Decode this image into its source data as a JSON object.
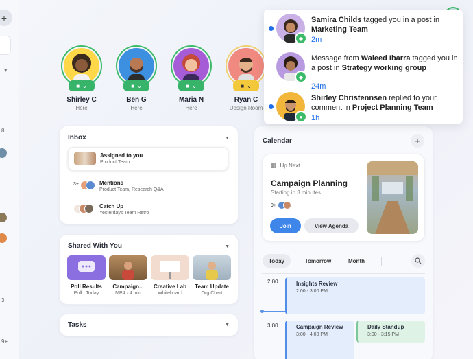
{
  "rail": {
    "plus_icon": "+",
    "chev_icon": "▾",
    "nums": [
      "8",
      "3",
      "9+"
    ]
  },
  "people": [
    {
      "name": "Shirley C",
      "status": "Here"
    },
    {
      "name": "Ben G",
      "status": "Here"
    },
    {
      "name": "Maria N",
      "status": "Here"
    },
    {
      "name": "Ryan C",
      "status": "Design Room"
    }
  ],
  "inbox": {
    "title": "Inbox",
    "items": [
      {
        "title": "Assigned to you",
        "subtitle": "Product Team"
      },
      {
        "title": "Mentions",
        "subtitle": "Product Team, Research Q&A",
        "count": "3+"
      },
      {
        "title": "Catch Up",
        "subtitle": "Yesterdays Team Retro"
      }
    ]
  },
  "shared": {
    "title": "Shared With You",
    "items": [
      {
        "title": "Poll Results",
        "subtitle": "Poll · Today"
      },
      {
        "title": "Campaign...",
        "subtitle": "MP4 · 4 min"
      },
      {
        "title": "Creative Lab",
        "subtitle": "Whiteboard"
      },
      {
        "title": "Team Update",
        "subtitle": "Org Chart"
      }
    ]
  },
  "tasks": {
    "title": "Tasks"
  },
  "calendar": {
    "title": "Calendar",
    "upnext_label": "Up Next",
    "event_title": "Campaign Planning",
    "event_sub": "Starting in 3 minutes",
    "attendee_count": "9+",
    "join_label": "Join",
    "agenda_label": "View Agenda",
    "tabs": [
      "Today",
      "Tomorrow",
      "Month"
    ],
    "hours": [
      "2:00",
      "3:00"
    ],
    "events": [
      {
        "title": "Insights Review",
        "time": "2:00 - 3:00 PM"
      },
      {
        "title": "Campaign Review",
        "time": "3:00 - 4:00 PM"
      },
      {
        "title": "Daily Standup",
        "time": "3:00 - 3:15 PM"
      }
    ]
  },
  "notifications": [
    {
      "pre": "",
      "actor": "Samira Childs",
      "mid": " tagged you in a post in ",
      "target": "Marketing Team",
      "time": "2m"
    },
    {
      "pre": "Message from ",
      "actor": "Waleed Ibarra",
      "mid": " tagged you in a post in ",
      "target": "Strategy working group",
      "time": "24m"
    },
    {
      "pre": "",
      "actor": "Shirley Christennsen",
      "mid": " replied to your comment in ",
      "target": "Project Planning Team",
      "time": "1h"
    }
  ],
  "colors": {
    "accent": "#1e6fe8",
    "presence": "#3dbb6a",
    "away": "#f3c93b"
  }
}
